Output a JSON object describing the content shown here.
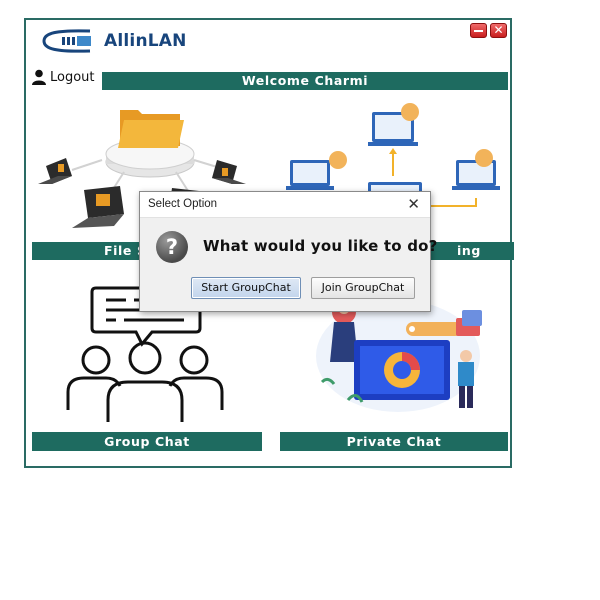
{
  "app": {
    "brand": "AllinLAN"
  },
  "header": {
    "logout_label": "Logout",
    "welcome_text": "Welcome Charmi"
  },
  "tiles": {
    "file_sharing": "File S",
    "screen_sharing": "ing",
    "group_chat": "Group Chat",
    "private_chat": "Private Chat"
  },
  "dialog": {
    "title": "Select Option",
    "close_glyph": "✕",
    "icon_glyph": "?",
    "question": "What would you like to do?",
    "start_label": "Start GroupChat",
    "join_label": "Join GroupChat"
  },
  "window_controls": {
    "close_glyph": "✕"
  },
  "colors": {
    "accent": "#1e6b60",
    "brand": "#18457c",
    "window_button": "#d32f2f"
  }
}
